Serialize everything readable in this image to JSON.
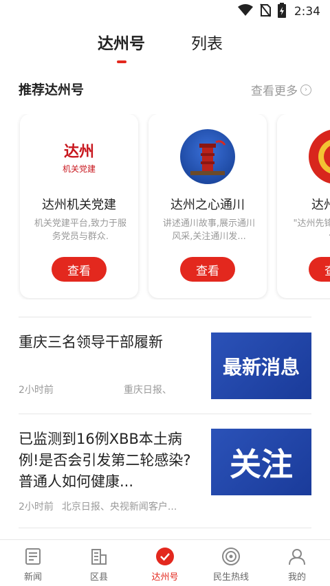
{
  "status_bar": {
    "time": "2:34"
  },
  "top_tabs": [
    {
      "label": "达州号",
      "active": true
    },
    {
      "label": "列表",
      "active": false
    }
  ],
  "section": {
    "title": "推荐达州号",
    "more_label": "查看更多"
  },
  "cards": [
    {
      "name": "达州机关党建",
      "desc": "机关党建平台,致力于服务党员与群众.",
      "button": "查看",
      "logo_text": "达州",
      "logo_sub": "机关党建"
    },
    {
      "name": "达州之心通川",
      "desc": "讲述通川故事,展示通川风采,关注通川发...",
      "button": "查看"
    },
    {
      "name": "达州先锋",
      "desc": "\"达州先锋\"达州组织工作...",
      "button": "查看"
    }
  ],
  "news": [
    {
      "title": "重庆三名领导干部履新",
      "time": "2小时前",
      "source": "重庆日报、",
      "thumb_text": "最新消息"
    },
    {
      "title": "已监测到16例XBB本土病例!是否会引发第二轮感染?普通人如何健康...",
      "time": "2小时前",
      "source": "北京日报、央视新闻客户...",
      "thumb_text": "关注"
    }
  ],
  "bottom_nav": [
    {
      "label": "新闻",
      "icon": "news-icon",
      "active": false
    },
    {
      "label": "区县",
      "icon": "district-icon",
      "active": false
    },
    {
      "label": "达州号",
      "icon": "check-circle-icon",
      "active": true
    },
    {
      "label": "民生热线",
      "icon": "hotline-icon",
      "active": false
    },
    {
      "label": "我的",
      "icon": "profile-icon",
      "active": false
    }
  ],
  "colors": {
    "accent": "#e3281e",
    "thumb_blue": "#2b52b8"
  }
}
